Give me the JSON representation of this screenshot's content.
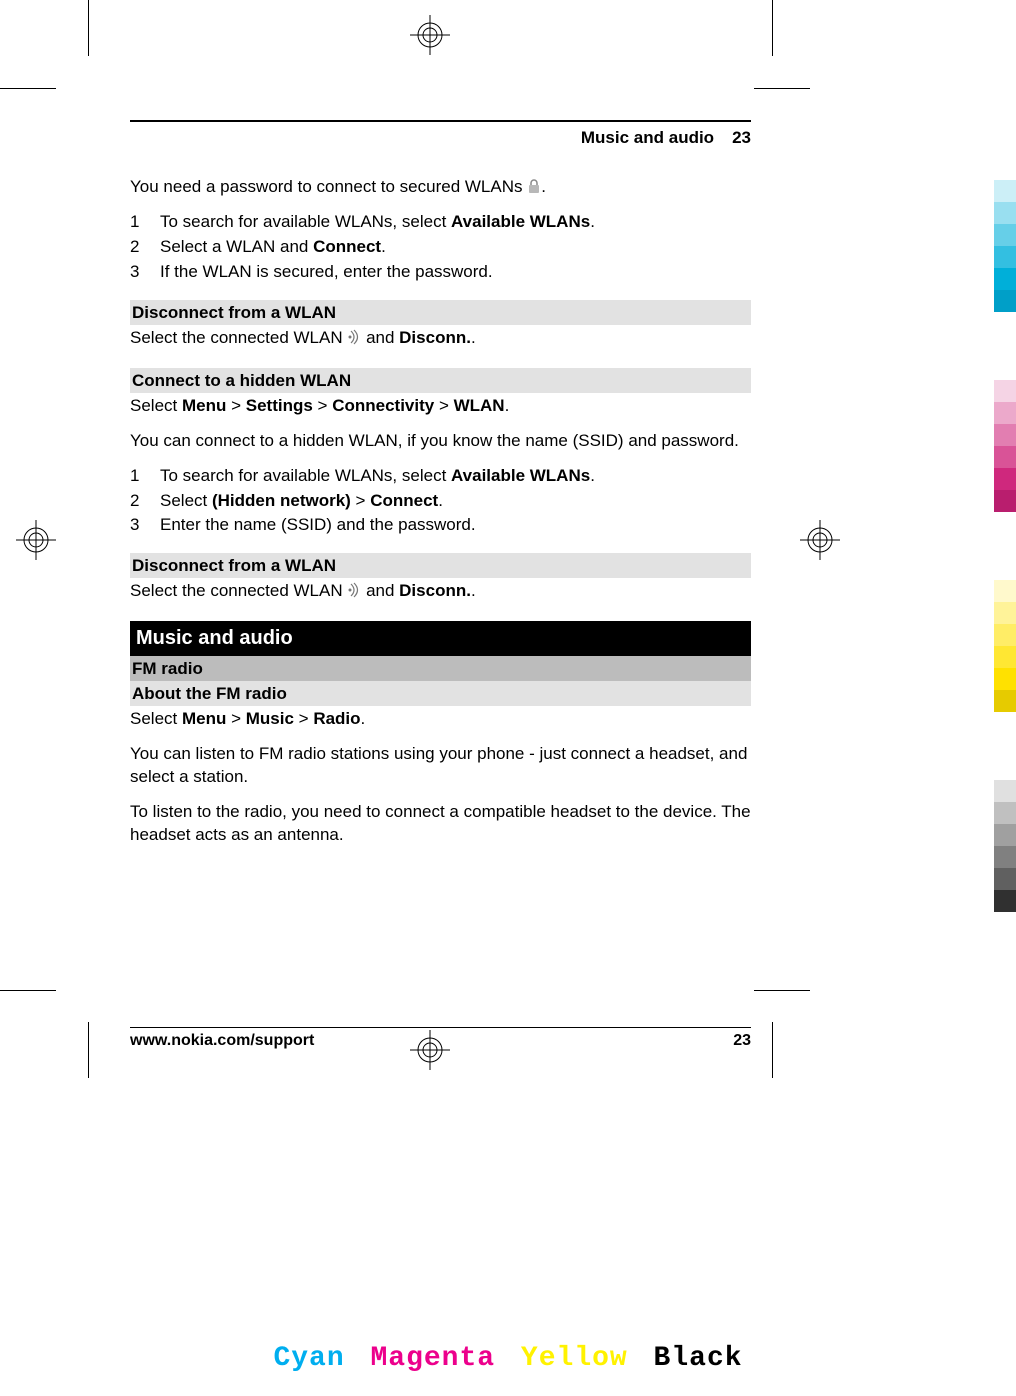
{
  "header": {
    "title": "Music and audio",
    "page": "23"
  },
  "intro": {
    "secured_note_pre": "You need a password to connect to secured WLANs ",
    "secured_note_post": "."
  },
  "list1": {
    "n1": "1",
    "i1_pre": "To search for available WLANs, select ",
    "i1_bold": "Available WLANs",
    "i1_post": ".",
    "n2": "2",
    "i2_pre": "Select a WLAN and ",
    "i2_bold": "Connect",
    "i2_post": ".",
    "n3": "3",
    "i3": "If the WLAN is secured, enter the password."
  },
  "disconnect1": {
    "heading": "Disconnect from a WLAN",
    "pre": "Select the connected WLAN ",
    "mid": " and ",
    "bold": "Disconn.",
    "post": "."
  },
  "hidden": {
    "heading": "Connect to a hidden WLAN",
    "path_pre": "Select ",
    "p1": "Menu",
    "sep1": " > ",
    "p2": "Settings",
    "sep2": " > ",
    "p3": "Connectivity",
    "sep3": " > ",
    "p4": "WLAN",
    "path_post": ".",
    "desc": "You can connect to a hidden WLAN, if you know the name (SSID) and password."
  },
  "list2": {
    "n1": "1",
    "i1_pre": "To search for available WLANs, select ",
    "i1_bold": "Available WLANs",
    "i1_post": ".",
    "n2": "2",
    "i2_pre": "Select ",
    "i2_bold1": "(Hidden network)",
    "i2_mid": " > ",
    "i2_bold2": "Connect",
    "i2_post": ".",
    "n3": "3",
    "i3": "Enter the name (SSID) and the password."
  },
  "disconnect2": {
    "heading": "Disconnect from a WLAN",
    "pre": "Select the connected WLAN ",
    "mid": " and ",
    "bold": "Disconn.",
    "post": "."
  },
  "section": {
    "title": "Music and audio"
  },
  "fm": {
    "sub1": "FM radio",
    "sub2": "About the FM radio",
    "path_pre": "Select ",
    "p1": "Menu",
    "sep1": " > ",
    "p2": "Music",
    "sep2": " > ",
    "p3": "Radio",
    "path_post": ".",
    "para1": "You can listen to FM radio stations using your phone - just connect a headset, and select a station.",
    "para2": "To listen to the radio, you need to connect a compatible headset to the device. The headset acts as an antenna."
  },
  "footer": {
    "url": "www.nokia.com/support",
    "page": "23"
  },
  "process": {
    "c": "Cyan",
    "m": "Magenta",
    "y": "Yellow",
    "k": "Black"
  },
  "colors": {
    "cyan_bars": [
      "#cceff7",
      "#99dff0",
      "#66cfe8",
      "#33bfe1",
      "#00afd9",
      "#009fc8"
    ],
    "magenta_bars": [
      "#f5d4e5",
      "#eca9cb",
      "#e27eb1",
      "#d95397",
      "#cf287d",
      "#b91e6e"
    ],
    "yellow_bars": [
      "#fff9cc",
      "#fff399",
      "#ffed66",
      "#ffe733",
      "#ffe100",
      "#e6cb00"
    ],
    "gray_bars": [
      "#e0e0e0",
      "#c0c0c0",
      "#a0a0a0",
      "#808080",
      "#606060",
      "#303030"
    ]
  }
}
